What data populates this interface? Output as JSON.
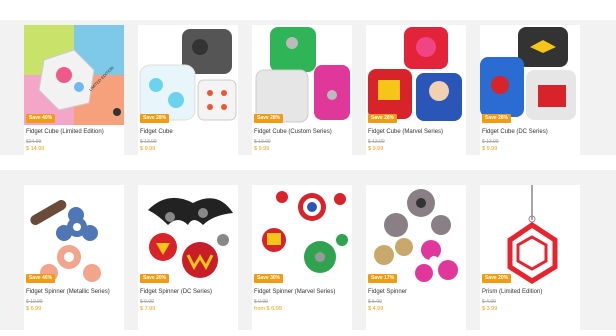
{
  "row1": [
    {
      "title": "Fidget Cube (Limited Edition)",
      "badge": "Save 40%",
      "old_price": "$24.99",
      "price": "$ 14.99"
    },
    {
      "title": "Fidget Cube",
      "badge": "Save 28%",
      "old_price": "$ 13.99",
      "price": "$ 9.99"
    },
    {
      "title": "Fidget Cube (Custom Series)",
      "badge": "Save 28%",
      "old_price": "$ 13.99",
      "price": "$ 9.99"
    },
    {
      "title": "Fidget Cube (Marvel Series)",
      "badge": "Save 28%",
      "old_price": "$ 13.99",
      "price": "$ 9.99"
    },
    {
      "title": "Fidget Cube (DC Series)",
      "badge": "Save 28%",
      "old_price": "$ 13.99",
      "price": "$ 9.99"
    }
  ],
  "row2": [
    {
      "title": "Fidget Spinner (Metallic Series)",
      "badge": "Save 46%",
      "old_price": "$ 12.99",
      "price": "$ 6.99"
    },
    {
      "title": "Fidget Spinner (DC Series)",
      "badge": "Save 20%",
      "old_price": "$ 9.99",
      "price": "$ 7.99"
    },
    {
      "title": "Fidget Spinner (Marvel Series)",
      "badge": "Save 30%",
      "old_price": "$ 9.99",
      "price": "from $ 6.99"
    },
    {
      "title": "Fidget Spinner",
      "badge": "Save 17%",
      "old_price": "$ 5.99",
      "price": "$ 4.99"
    },
    {
      "title": "Prism (Limited Edition)",
      "badge": "Save 20%",
      "old_price": "$ 4.99",
      "price": "$ 3.99"
    }
  ],
  "colors": {
    "accent": "#f39b13",
    "band": "#f2f2f2"
  }
}
